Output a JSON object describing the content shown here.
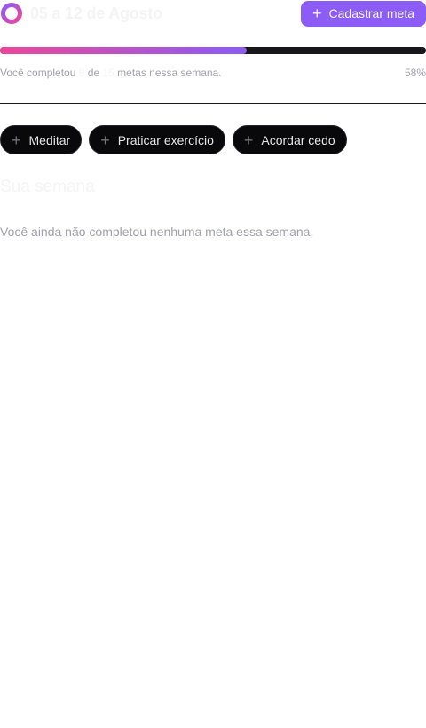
{
  "header": {
    "title": "05 a 12 de Agosto",
    "create_goal_label": "Cadastrar meta",
    "plus_icon": "plus-icon",
    "logo_icon": "ring-logo-icon"
  },
  "progress": {
    "percent": 58,
    "percent_label": "58%",
    "prefix": "Você completou",
    "completed": "8",
    "connector": "de",
    "total": "15",
    "suffix": "metas nessa semana."
  },
  "pending_goals": [
    {
      "label": "Meditar"
    },
    {
      "label": "Praticar exercício"
    },
    {
      "label": "Acordar cedo"
    }
  ],
  "summary": {
    "section_title": "Sua semana",
    "empty_message": "Você ainda não completou nenhuma meta essa semana."
  },
  "colors": {
    "accent": "#8b5cf6",
    "gradient_start": "#ec4899",
    "gradient_end": "#8b5cf6",
    "track": "#18181b"
  }
}
